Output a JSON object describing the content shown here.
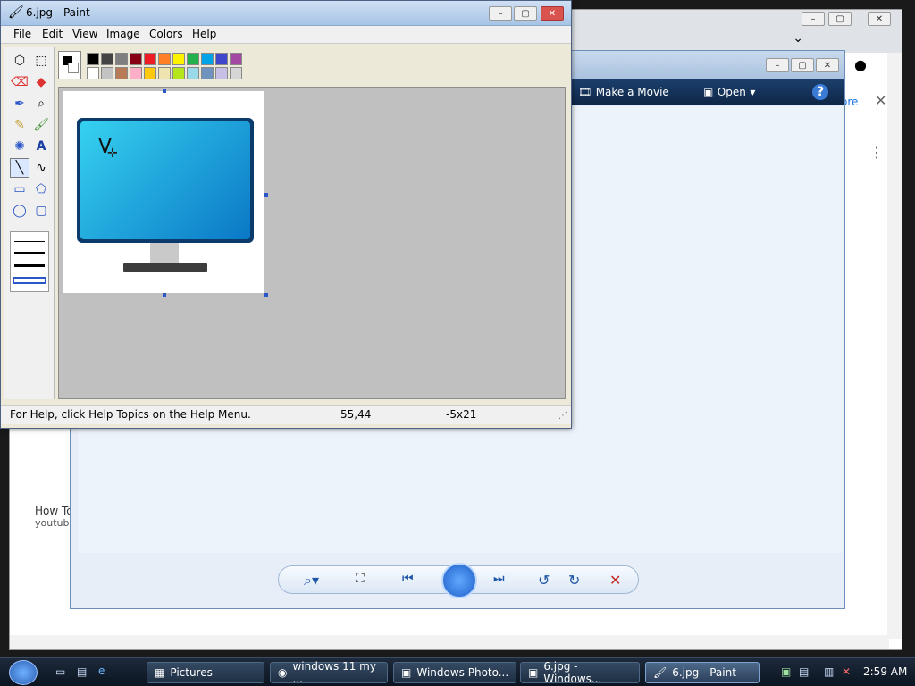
{
  "browser": {
    "side_texts": {
      "how_to": "How To",
      "youtube": "youtube",
      "ore": "ore"
    }
  },
  "photo_gallery": {
    "toolbar": {
      "make_movie": "Make a Movie",
      "open": "Open"
    }
  },
  "paint": {
    "title": "6.jpg - Paint",
    "menu": [
      "File",
      "Edit",
      "View",
      "Image",
      "Colors",
      "Help"
    ],
    "palette": {
      "primary": "#000000",
      "secondary": "#ffffff",
      "swatches": [
        "#000000",
        "#444444",
        "#7f7f7f",
        "#880015",
        "#ed1c24",
        "#ff7f27",
        "#fff200",
        "#22b14c",
        "#00a2e8",
        "#3f48cc",
        "#a349a4",
        "#ffffff",
        "#c3c3c3",
        "#b97a57",
        "#ffaec9",
        "#ffc90e",
        "#efe4b0",
        "#b5e61d",
        "#99d9ea",
        "#7092be",
        "#c8bfe7",
        "#d6d6d6"
      ]
    },
    "status": {
      "help": "For Help, click Help Topics on the Help Menu.",
      "coords": "55,44",
      "size": "-5x21"
    }
  },
  "taskbar": {
    "items": [
      {
        "label": "Pictures"
      },
      {
        "label": "windows 11 my ..."
      },
      {
        "label": "Windows Photo..."
      },
      {
        "label": "6.jpg - Windows..."
      },
      {
        "label": "6.jpg - Paint"
      }
    ],
    "time": "2:59 AM"
  }
}
